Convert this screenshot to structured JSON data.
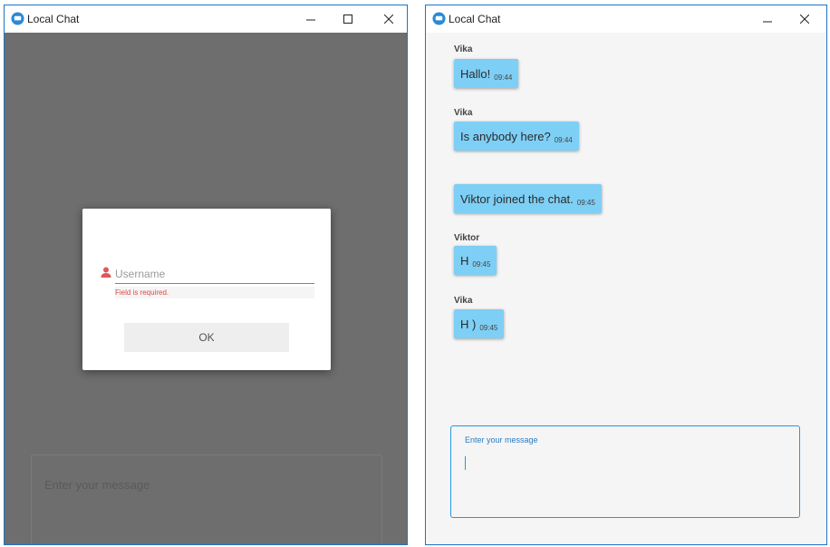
{
  "left_window": {
    "title": "Local Chat",
    "controls": {
      "minimize": "—",
      "maximize": "☐",
      "close": "✕"
    },
    "dialog": {
      "username_placeholder": "Username",
      "error": "Field is required.",
      "ok_label": "OK"
    },
    "message_placeholder": "Enter your message"
  },
  "right_window": {
    "title": "Local Chat",
    "controls": {
      "minimize": "—",
      "close": "✕"
    },
    "messages": [
      {
        "sender": "Vika",
        "text": "Hallo!",
        "time": "09:44"
      },
      {
        "sender": "Vika",
        "text": "Is anybody here?",
        "time": "09:44"
      },
      {
        "sender": "",
        "text": "Viktor joined the chat.",
        "time": "09:45"
      },
      {
        "sender": "Viktor",
        "text": "H",
        "time": "09:45"
      },
      {
        "sender": "Vika",
        "text": "H )",
        "time": "09:45"
      }
    ],
    "message_label": "Enter your message"
  },
  "colors": {
    "bubble": "#7ecff5",
    "accent": "#2596e6",
    "error": "#e04848",
    "overlay": "#6e6e6e"
  },
  "icons": {
    "app": "chat-bubble-icon",
    "user": "user-icon"
  }
}
